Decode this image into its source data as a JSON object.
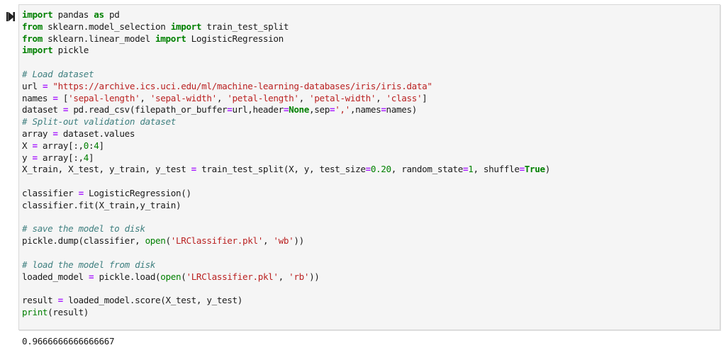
{
  "cell": {
    "run_icon": "step-run-icon",
    "lines": [
      [
        {
          "t": "kw",
          "v": "import"
        },
        {
          "t": "",
          "v": " pandas "
        },
        {
          "t": "kw",
          "v": "as"
        },
        {
          "t": "",
          "v": " pd"
        }
      ],
      [
        {
          "t": "kw",
          "v": "from"
        },
        {
          "t": "",
          "v": " sklearn.model_selection "
        },
        {
          "t": "kw",
          "v": "import"
        },
        {
          "t": "",
          "v": " train_test_split"
        }
      ],
      [
        {
          "t": "kw",
          "v": "from"
        },
        {
          "t": "",
          "v": " sklearn.linear_model "
        },
        {
          "t": "kw",
          "v": "import"
        },
        {
          "t": "",
          "v": " LogisticRegression"
        }
      ],
      [
        {
          "t": "kw",
          "v": "import"
        },
        {
          "t": "",
          "v": " pickle"
        }
      ],
      [],
      [
        {
          "t": "cm",
          "v": "# Load dataset"
        }
      ],
      [
        {
          "t": "",
          "v": "url "
        },
        {
          "t": "op",
          "v": "="
        },
        {
          "t": "",
          "v": " "
        },
        {
          "t": "str",
          "v": "\"https://archive.ics.uci.edu/ml/machine-learning-databases/iris/iris.data\""
        }
      ],
      [
        {
          "t": "",
          "v": "names "
        },
        {
          "t": "op",
          "v": "="
        },
        {
          "t": "",
          "v": " ["
        },
        {
          "t": "str",
          "v": "'sepal-length'"
        },
        {
          "t": "",
          "v": ", "
        },
        {
          "t": "str",
          "v": "'sepal-width'"
        },
        {
          "t": "",
          "v": ", "
        },
        {
          "t": "str",
          "v": "'petal-length'"
        },
        {
          "t": "",
          "v": ", "
        },
        {
          "t": "str",
          "v": "'petal-width'"
        },
        {
          "t": "",
          "v": ", "
        },
        {
          "t": "str",
          "v": "'class'"
        },
        {
          "t": "",
          "v": "]"
        }
      ],
      [
        {
          "t": "",
          "v": "dataset "
        },
        {
          "t": "op",
          "v": "="
        },
        {
          "t": "",
          "v": " pd.read_csv(filepath_or_buffer"
        },
        {
          "t": "op",
          "v": "="
        },
        {
          "t": "",
          "v": "url,header"
        },
        {
          "t": "op",
          "v": "="
        },
        {
          "t": "kw",
          "v": "None"
        },
        {
          "t": "",
          "v": ",sep"
        },
        {
          "t": "op",
          "v": "="
        },
        {
          "t": "str",
          "v": "','"
        },
        {
          "t": "",
          "v": ",names"
        },
        {
          "t": "op",
          "v": "="
        },
        {
          "t": "",
          "v": "names)"
        }
      ],
      [
        {
          "t": "cm",
          "v": "# Split-out validation dataset"
        }
      ],
      [
        {
          "t": "",
          "v": "array "
        },
        {
          "t": "op",
          "v": "="
        },
        {
          "t": "",
          "v": " dataset.values"
        }
      ],
      [
        {
          "t": "",
          "v": "X "
        },
        {
          "t": "op",
          "v": "="
        },
        {
          "t": "",
          "v": " array[:,"
        },
        {
          "t": "num",
          "v": "0"
        },
        {
          "t": "",
          "v": ":"
        },
        {
          "t": "num",
          "v": "4"
        },
        {
          "t": "",
          "v": "]"
        }
      ],
      [
        {
          "t": "",
          "v": "y "
        },
        {
          "t": "op",
          "v": "="
        },
        {
          "t": "",
          "v": " array[:,"
        },
        {
          "t": "num",
          "v": "4"
        },
        {
          "t": "",
          "v": "]"
        }
      ],
      [
        {
          "t": "",
          "v": "X_train, X_test, y_train, y_test "
        },
        {
          "t": "op",
          "v": "="
        },
        {
          "t": "",
          "v": " train_test_split(X, y, test_size"
        },
        {
          "t": "op",
          "v": "="
        },
        {
          "t": "num",
          "v": "0.20"
        },
        {
          "t": "",
          "v": ", random_state"
        },
        {
          "t": "op",
          "v": "="
        },
        {
          "t": "num",
          "v": "1"
        },
        {
          "t": "",
          "v": ", shuffle"
        },
        {
          "t": "op",
          "v": "="
        },
        {
          "t": "kw",
          "v": "True"
        },
        {
          "t": "",
          "v": ")"
        }
      ],
      [],
      [
        {
          "t": "",
          "v": "classifier "
        },
        {
          "t": "op",
          "v": "="
        },
        {
          "t": "",
          "v": " LogisticRegression()"
        }
      ],
      [
        {
          "t": "",
          "v": "classifier.fit(X_train,y_train)"
        }
      ],
      [],
      [
        {
          "t": "cm",
          "v": "# save the model to disk"
        }
      ],
      [
        {
          "t": "",
          "v": "pickle.dump(classifier, "
        },
        {
          "t": "bi",
          "v": "open"
        },
        {
          "t": "",
          "v": "("
        },
        {
          "t": "str",
          "v": "'LRClassifier.pkl'"
        },
        {
          "t": "",
          "v": ", "
        },
        {
          "t": "str",
          "v": "'wb'"
        },
        {
          "t": "",
          "v": "))"
        }
      ],
      [],
      [
        {
          "t": "cm",
          "v": "# load the model from disk"
        }
      ],
      [
        {
          "t": "",
          "v": "loaded_model "
        },
        {
          "t": "op",
          "v": "="
        },
        {
          "t": "",
          "v": " pickle.load("
        },
        {
          "t": "bi",
          "v": "open"
        },
        {
          "t": "",
          "v": "("
        },
        {
          "t": "str",
          "v": "'LRClassifier.pkl'"
        },
        {
          "t": "",
          "v": ", "
        },
        {
          "t": "str",
          "v": "'rb'"
        },
        {
          "t": "",
          "v": "))"
        }
      ],
      [],
      [
        {
          "t": "",
          "v": "result "
        },
        {
          "t": "op",
          "v": "="
        },
        {
          "t": "",
          "v": " loaded_model.score(X_test, y_test)"
        }
      ],
      [
        {
          "t": "bi",
          "v": "print"
        },
        {
          "t": "",
          "v": "(result)"
        }
      ]
    ]
  },
  "output": {
    "text": "0.9666666666666667"
  }
}
